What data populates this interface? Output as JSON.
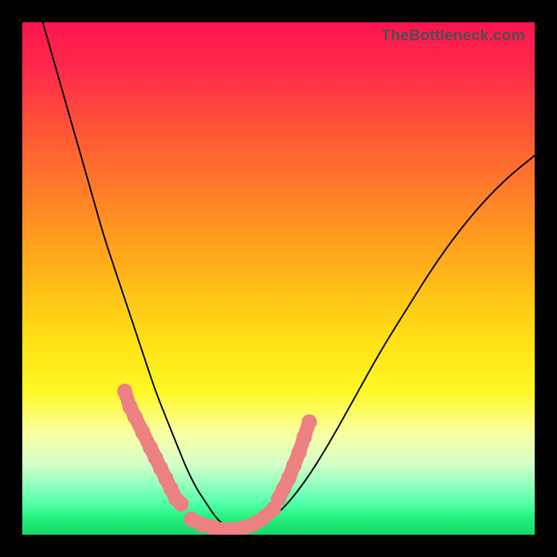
{
  "watermark": "TheBottleneck.com",
  "colors": {
    "frame": "#000000",
    "curve_stroke": "#000000",
    "marker_fill": "#ed8080",
    "gradient_top": "#ff1450",
    "gradient_bottom": "#17d86a"
  },
  "chart_data": {
    "type": "line",
    "title": "",
    "xlabel": "",
    "ylabel": "",
    "xlim": [
      0,
      100
    ],
    "ylim": [
      0,
      100
    ],
    "grid": false,
    "legend": false,
    "series": [
      {
        "name": "bottleneck-curve",
        "x": [
          4,
          6,
          8,
          10,
          12,
          14,
          16,
          18,
          20,
          22,
          24,
          26,
          28,
          30,
          32,
          34,
          36,
          38,
          40,
          45,
          50,
          55,
          60,
          65,
          70,
          75,
          80,
          85,
          90,
          95,
          100
        ],
        "values": [
          100,
          93,
          86,
          79,
          72,
          65,
          58,
          52,
          46,
          40,
          34,
          28,
          23,
          18,
          13,
          9,
          6,
          3,
          1.5,
          1,
          4,
          10,
          18,
          27,
          36,
          44,
          52,
          59,
          65,
          70,
          74
        ]
      }
    ],
    "markers": [
      {
        "name": "left-cluster",
        "x": [
          20,
          21,
          22,
          23.5,
          25,
          26,
          27,
          28,
          29,
          30,
          31
        ],
        "values": [
          28,
          25,
          23,
          20,
          17,
          15,
          13,
          11,
          9,
          7,
          6
        ]
      },
      {
        "name": "trough-cluster",
        "x": [
          33,
          35,
          37,
          39,
          41,
          43,
          45,
          47,
          49
        ],
        "values": [
          3,
          2,
          1.5,
          1,
          1,
          1.3,
          2,
          3.2,
          5
        ]
      },
      {
        "name": "right-cluster",
        "x": [
          50,
          51,
          52,
          53,
          54,
          55,
          56
        ],
        "values": [
          7,
          9,
          11,
          13.5,
          16,
          19,
          22
        ]
      }
    ],
    "annotations": []
  }
}
